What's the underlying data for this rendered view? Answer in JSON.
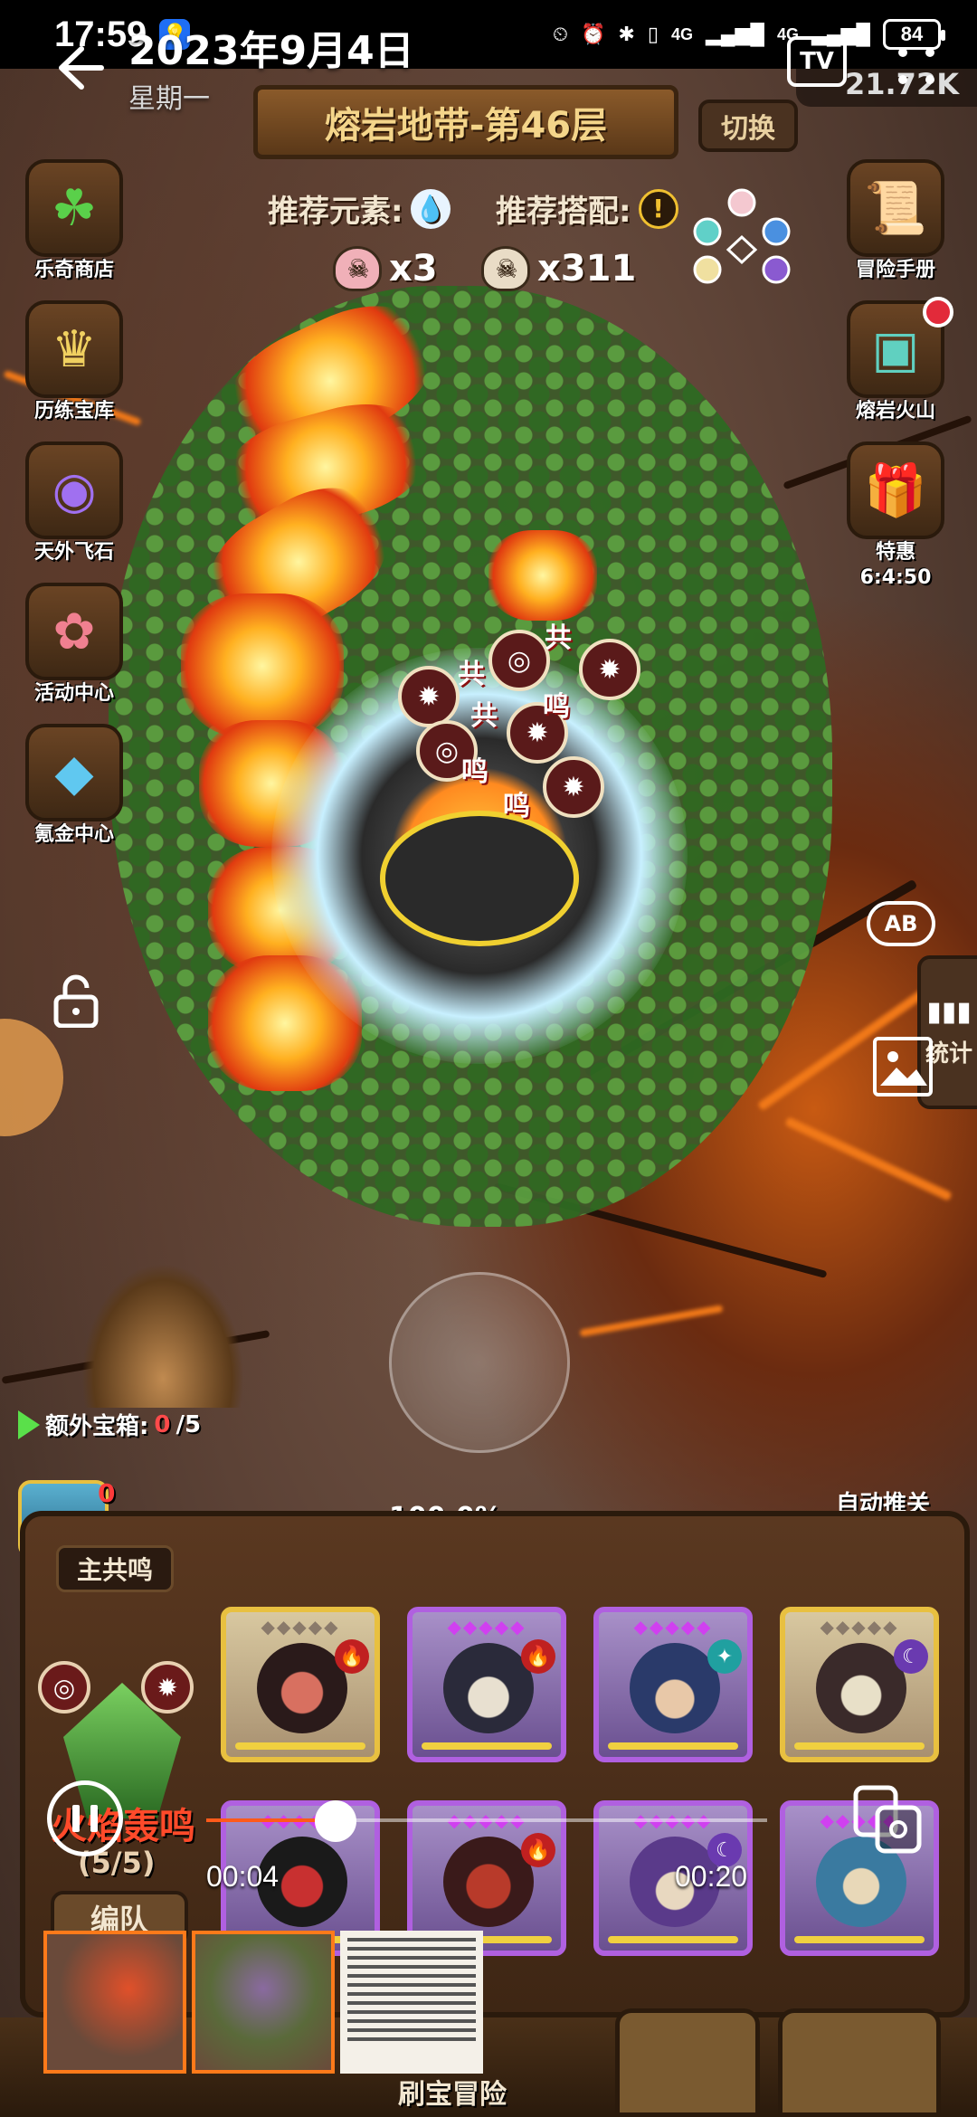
{
  "status_bar": {
    "time": "17:59",
    "network_1": "4G",
    "network_2": "4G",
    "battery": "84"
  },
  "viewer": {
    "date_title": "2023年9月4日",
    "weekday": "星期一",
    "tv_label": "TV"
  },
  "game": {
    "level_title": "熔岩地带-第46层",
    "switch_label": "切换",
    "gold": "21.72K",
    "recommend_element_label": "推荐元素:",
    "recommend_combo_label": "推荐搭配:",
    "kills_a": "x3",
    "kills_b": "x311",
    "left_menu": [
      {
        "label": "乐奇商店",
        "icon": "clover-icon"
      },
      {
        "label": "历练宝库",
        "icon": "treasury-icon"
      },
      {
        "label": "天外飞石",
        "icon": "portal-icon"
      },
      {
        "label": "活动中心",
        "icon": "gift-bouquet-icon"
      },
      {
        "label": "氪金中心",
        "icon": "diamond-icon"
      }
    ],
    "right_menu": [
      {
        "label": "冒险手册",
        "icon": "scroll-icon"
      },
      {
        "label": "熔岩火山",
        "icon": "chest-icon"
      },
      {
        "label": "特惠",
        "sublabel": "6:4:50",
        "icon": "gift-box-icon"
      }
    ],
    "floating_texts": [
      "共",
      "共",
      "共",
      "鸣",
      "鸣",
      "鸣"
    ],
    "stats_label": "统计",
    "ab_label": "AB",
    "extra_chest_label": "额外宝箱:",
    "extra_chest_value": "0",
    "extra_chest_total": "/5",
    "chest_count": "0",
    "progress_text": "100.0%",
    "progress_value": 1.0,
    "auto_label": "自动推关",
    "auto_toggle": "ON",
    "team_tag": "主共鸣",
    "resonance_title": "火焰轰鸣",
    "resonance_count": "(5/5)",
    "formation_label": "编队",
    "dock_label": "刷宝冒险"
  },
  "player": {
    "current_time": "00:04",
    "total_time": "00:20",
    "progress": 0.2
  },
  "colors": {
    "accent_orange": "#ff5a1a",
    "toggle_green": "#5ad04a",
    "red_text": "#ff4a2a"
  }
}
